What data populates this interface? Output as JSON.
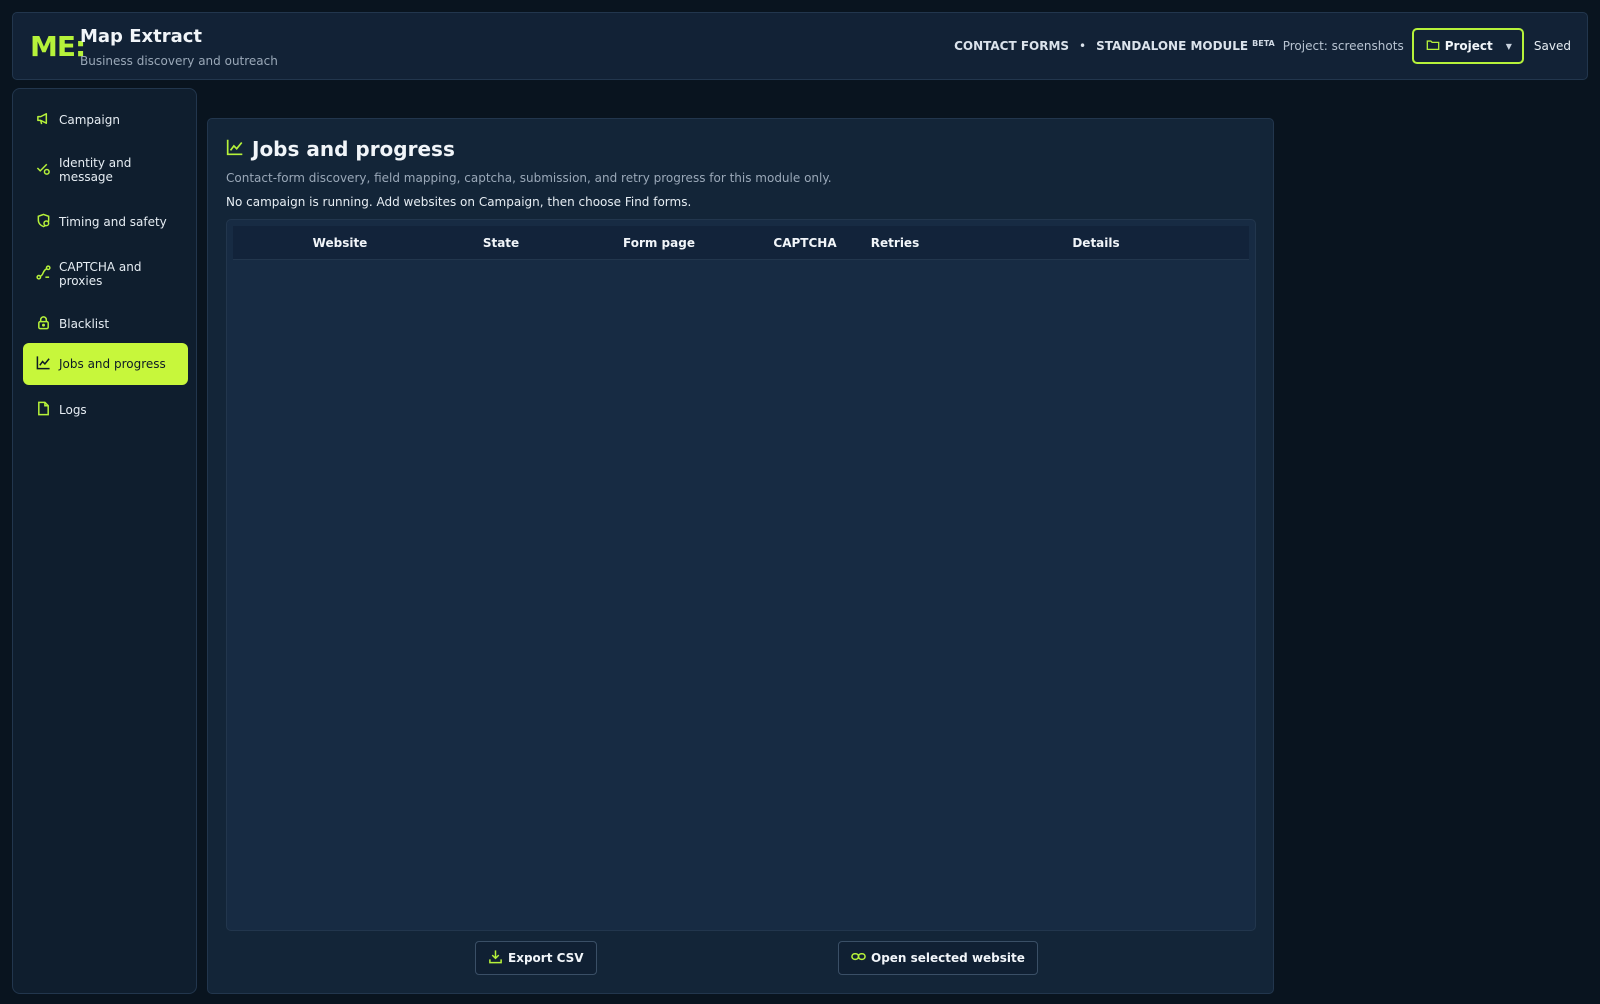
{
  "header": {
    "logo": "ME:",
    "title": "Map Extract",
    "subtitle": "Business discovery and outreach",
    "crumb_1": "CONTACT FORMS",
    "separator": "•",
    "crumb_2": "STANDALONE MODULE",
    "badge": "BETA",
    "project_label": "Project: screenshots",
    "project_button": "Project",
    "saved_status": "Saved"
  },
  "sidebar": {
    "items": [
      {
        "label": "Campaign",
        "icon": "megaphone-icon"
      },
      {
        "label": "Identity and message",
        "icon": "check-badge-icon"
      },
      {
        "label": "Timing and safety",
        "icon": "shield-clock-icon"
      },
      {
        "label": "CAPTCHA and proxies",
        "icon": "route-icon"
      },
      {
        "label": "Blacklist",
        "icon": "lock-icon"
      },
      {
        "label": "Jobs and progress",
        "icon": "chart-line-icon"
      },
      {
        "label": "Logs",
        "icon": "file-icon"
      }
    ],
    "active": "Jobs and progress"
  },
  "main": {
    "title": "Jobs and progress",
    "description": "Contact-form discovery, field mapping, captcha, submission, and retry progress for this module only.",
    "status": "No campaign is running. Add websites on Campaign, then choose Find forms.",
    "table": {
      "columns": [
        "Website",
        "State",
        "Form page",
        "CAPTCHA",
        "Retries",
        "Details"
      ],
      "rows": []
    },
    "export_button": "Export CSV",
    "open_button": "Open selected website"
  },
  "colors": {
    "accent": "#b6f23a",
    "active_nav": "#c7f73b",
    "background": "#09141f",
    "panel": "#132538"
  }
}
